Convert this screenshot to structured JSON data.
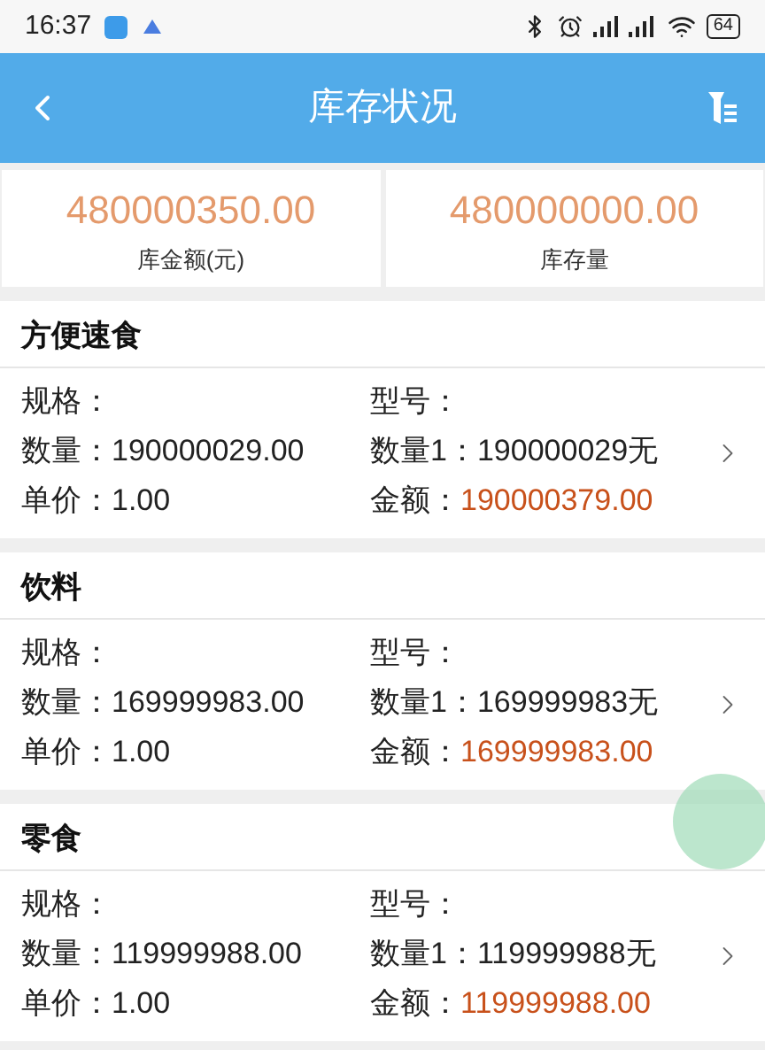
{
  "status_bar": {
    "time": "16:37",
    "battery": "64"
  },
  "header": {
    "title": "库存状况"
  },
  "summary": [
    {
      "value": "480000350.00",
      "label": "库金额(元)"
    },
    {
      "value": "480000000.00",
      "label": "库存量"
    }
  ],
  "items": [
    {
      "name": "方便速食",
      "spec_label": "规格：",
      "model_label": "型号：",
      "qty_label": "数量：",
      "qty": "190000029.00",
      "qty1_label": "数量1：",
      "qty1": "190000029无",
      "price_label": "单价：",
      "price": "1.00",
      "amount_label": "金额：",
      "amount": "190000379.00"
    },
    {
      "name": "饮料",
      "spec_label": "规格：",
      "model_label": "型号：",
      "qty_label": "数量：",
      "qty": "169999983.00",
      "qty1_label": "数量1：",
      "qty1": "169999983无",
      "price_label": "单价：",
      "price": "1.00",
      "amount_label": "金额：",
      "amount": "169999983.00"
    },
    {
      "name": "零食",
      "spec_label": "规格：",
      "model_label": "型号：",
      "qty_label": "数量：",
      "qty": "119999988.00",
      "qty1_label": "数量1：",
      "qty1": "119999988无",
      "price_label": "单价：",
      "price": "1.00",
      "amount_label": "金额：",
      "amount": "119999988.00"
    }
  ]
}
